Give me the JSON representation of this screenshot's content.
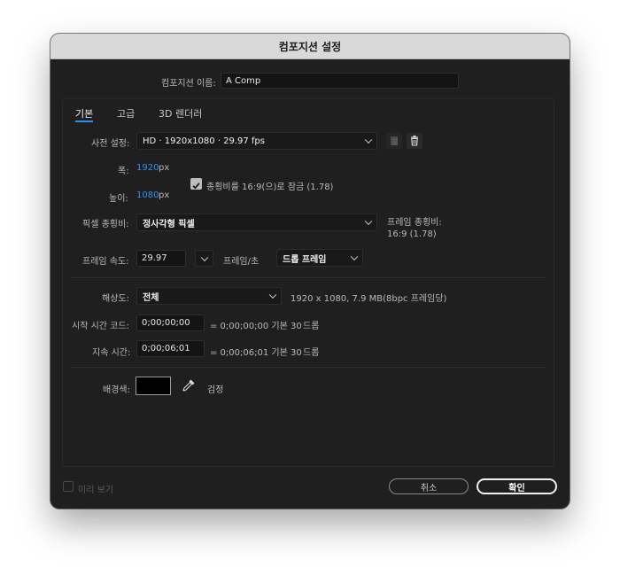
{
  "dialog": {
    "title": "컴포지션 설정"
  },
  "comp_name": {
    "label": "컴포지션 이름:",
    "value": "A Comp"
  },
  "tabs": [
    {
      "label": "기본"
    },
    {
      "label": "고급"
    },
    {
      "label": "3D 렌더러"
    }
  ],
  "preset": {
    "label": "사전 설정:",
    "value": "HD  ·  1920x1080 · 29.97 fps"
  },
  "width": {
    "label": "폭:",
    "value": "1920",
    "unit": "px"
  },
  "height": {
    "label": "높이:",
    "value": "1080",
    "unit": "px"
  },
  "lock_aspect": {
    "label": "종횡비를 16:9(으)로 잠금 (1.78)",
    "checked": true
  },
  "pixel_aspect": {
    "label": "픽셀 종횡비:",
    "value": "정사각형 픽셀"
  },
  "frame_aspect": {
    "label": "프레임 종횡비:",
    "value": "16:9 (1.78)"
  },
  "frame_rate": {
    "label": "프레임 속도:",
    "value": "29.97",
    "unit_label": "프레임/초",
    "mode": "드롭 프레임"
  },
  "resolution": {
    "label": "해상도:",
    "value": "전체",
    "info": "1920 x 1080, 7.9 MB(8bpc 프레임당)"
  },
  "start_timecode": {
    "label": "시작 시간 코드:",
    "value": "0;00;00;00",
    "equals": "= 0;00;00;00  기본 30",
    "mode": "드롭"
  },
  "duration": {
    "label": "지속 시간:",
    "value": "0;00;06;01",
    "equals": "= 0;00;06;01  기본 30",
    "mode": "드롭"
  },
  "background": {
    "label": "배경색:",
    "color_name": "검정",
    "color": "#000000"
  },
  "footer": {
    "preview_label": "미리 보기",
    "cancel_label": "취소",
    "ok_label": "확인"
  },
  "colors": {
    "accent": "#2f8ff0",
    "dialog_bg": "#1f1f1f",
    "titlebar_bg": "#d9d9d9"
  }
}
